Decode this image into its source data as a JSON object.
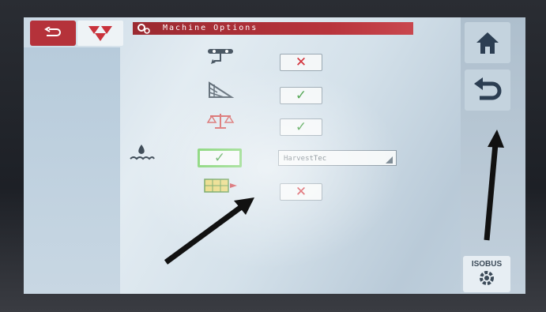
{
  "header": {
    "title": "Machine Options",
    "back_icon": "back-arrow-icon",
    "logo_icon": "brand-triangles-logo",
    "settings_icon": "gear-icon"
  },
  "options": [
    {
      "icon": "sprayer-nozzle-icon",
      "enabled": false
    },
    {
      "icon": "bale-chamber-icon",
      "enabled": true
    },
    {
      "icon": "scale-icon",
      "enabled": true
    },
    {
      "icon": "water-drop-icon",
      "enabled": true,
      "selected": true,
      "dropdown_value": "HarvestTec"
    },
    {
      "icon": "bale-count-icon",
      "enabled": false
    }
  ],
  "symbols": {
    "check": "✓",
    "cross": "✕"
  },
  "navigation": {
    "home_icon": "home-icon",
    "return_icon": "return-arrow-icon",
    "isobus_label": "ISOBUS",
    "isobus_icon": "isobus-settings-icon"
  },
  "colors": {
    "accent_red": "#b5323a",
    "check_green": "#3c9a3c",
    "cross_red": "#d2313a",
    "selection_green": "#6fcd5e"
  }
}
